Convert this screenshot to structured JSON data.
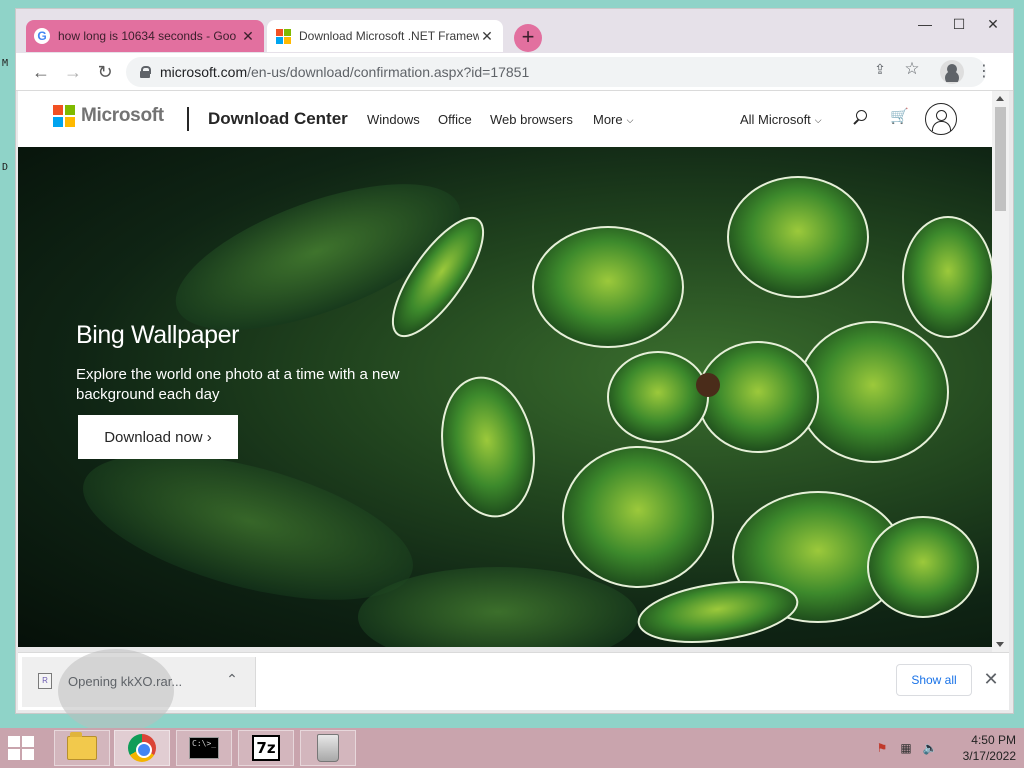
{
  "browser": {
    "tabs": [
      {
        "title": "how long is 10634 seconds - Goo",
        "favicon": "google-icon",
        "active": false
      },
      {
        "title": "Download Microsoft .NET Framew",
        "favicon": "microsoft-icon",
        "active": true
      }
    ],
    "new_tab_glyph": "+",
    "window_controls": {
      "minimize": "—",
      "maximize": "☐",
      "close": "✕"
    },
    "tab_close_glyph": "✕",
    "nav": {
      "back": "←",
      "forward": "→",
      "reload": "↻"
    },
    "url_host": "microsoft.com",
    "url_path": "/en-us/download/confirmation.aspx?id=17851",
    "menu_glyph": "⋮",
    "share_glyph": "⇪",
    "bookmark_glyph": "☆"
  },
  "site": {
    "brand": "Microsoft",
    "section": "Download Center",
    "nav": [
      "Windows",
      "Office",
      "Web browsers",
      "More"
    ],
    "more_chevron": "⌵",
    "all_microsoft": "All Microsoft",
    "cart_glyph": "🛒",
    "brand_colors": [
      "#f25022",
      "#7fba00",
      "#00a4ef",
      "#ffb900"
    ]
  },
  "hero": {
    "title": "Bing Wallpaper",
    "description": "Explore the world one photo at a time with a new background each day",
    "cta": "Download now ›"
  },
  "download_shelf": {
    "item_label": "Opening kkXO.rar...",
    "item_icon_text": "R",
    "chevron": "⌃",
    "show_all": "Show all",
    "close": "✕"
  },
  "desktop": {
    "edge_glyphs": [
      "M",
      "D"
    ]
  },
  "taskbar": {
    "clock_time": "4:50 PM",
    "clock_date": "3/17/2022",
    "cmd_icon_text": "C:\\>_",
    "zip_icon_text": "7z",
    "tray": [
      "⚑",
      "▦",
      "🔈"
    ]
  }
}
